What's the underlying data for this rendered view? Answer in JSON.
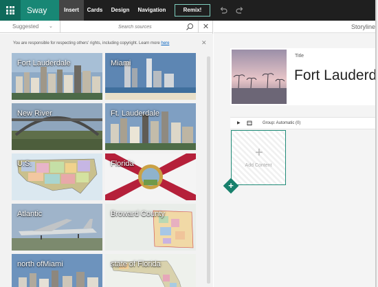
{
  "app": {
    "name": "Sway"
  },
  "nav": {
    "tabs": [
      {
        "label": "Insert",
        "active": true
      },
      {
        "label": "Cards",
        "active": false
      },
      {
        "label": "Design",
        "active": false
      },
      {
        "label": "Navigation",
        "active": false
      }
    ],
    "remix_label": "Remix!"
  },
  "insert_pane": {
    "source_select": "Suggested",
    "search_placeholder": "Search sources",
    "notice": "You are responsible for respecting others' rights, including copyright.",
    "learn_more_prefix": "Learn more",
    "learn_more_link": "here",
    "results": [
      {
        "label": "Fort Lauderdale",
        "icon": "city-skyline-photo"
      },
      {
        "label": "Miami",
        "icon": "city-skyline-photo"
      },
      {
        "label": "New River",
        "icon": "bridge-photo"
      },
      {
        "label": "Ft. Lauderdale",
        "icon": "city-skyline-photo"
      },
      {
        "label": "U.S.",
        "icon": "us-map"
      },
      {
        "label": "Florida",
        "icon": "florida-flag"
      },
      {
        "label": "Atlantic",
        "icon": "airplane-photo"
      },
      {
        "label": "Broward County",
        "icon": "county-map"
      },
      {
        "label": "north ofMiami",
        "icon": "city-skyline-photo"
      },
      {
        "label": "state of Florida",
        "icon": "florida-map"
      }
    ]
  },
  "storyline": {
    "header": "Storyline",
    "title_card": {
      "label": "Title",
      "value": "Fort Lauderdale"
    },
    "group": {
      "label": "Group: Automatic (0)"
    },
    "add_content": "Add Content"
  },
  "colors": {
    "brand": "#188775",
    "brand_dark": "#0f6a5b",
    "topbar": "#1f1f1f",
    "accent": "#1e8a77"
  }
}
